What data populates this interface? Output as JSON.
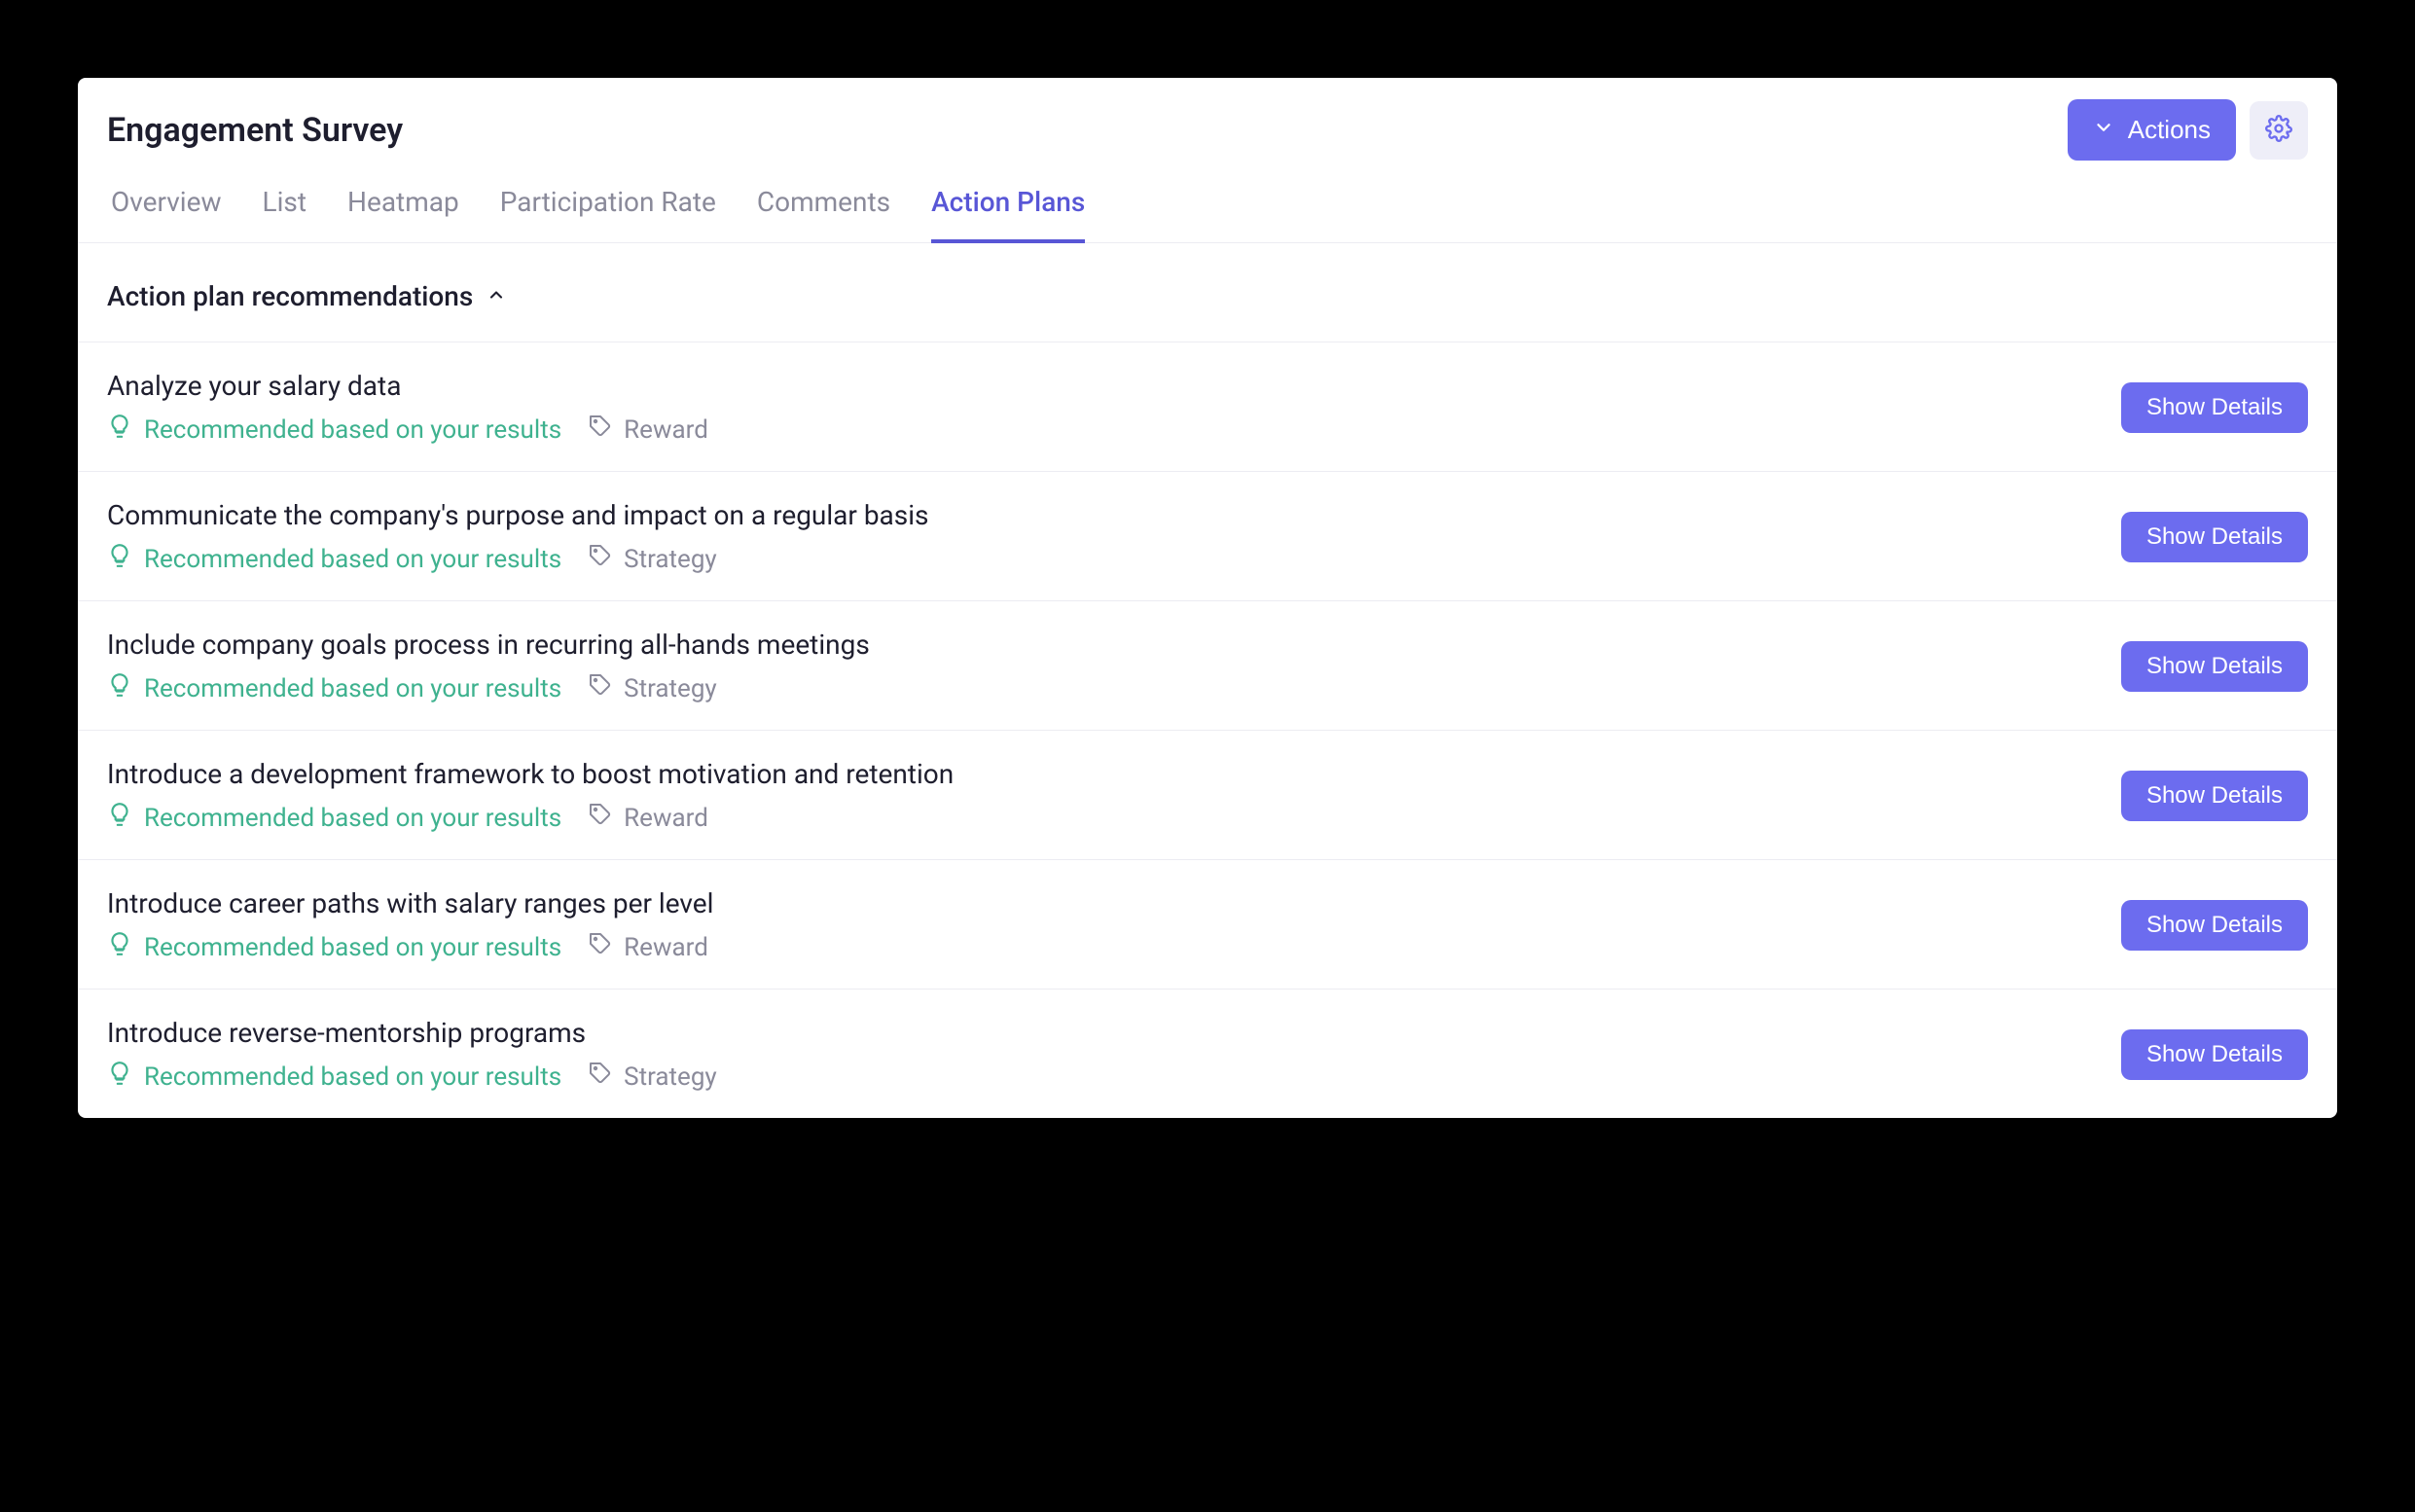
{
  "header": {
    "title": "Engagement Survey",
    "actions_label": "Actions"
  },
  "tabs": [
    {
      "label": "Overview",
      "active": false
    },
    {
      "label": "List",
      "active": false
    },
    {
      "label": "Heatmap",
      "active": false
    },
    {
      "label": "Participation Rate",
      "active": false
    },
    {
      "label": "Comments",
      "active": false
    },
    {
      "label": "Action Plans",
      "active": true
    }
  ],
  "section": {
    "title": "Action plan recommendations"
  },
  "common": {
    "recommended_label": "Recommended based on your results",
    "show_details_label": "Show Details"
  },
  "recommendations": [
    {
      "title": "Analyze your salary data",
      "category": "Reward"
    },
    {
      "title": "Communicate the company's purpose and impact on a regular basis",
      "category": "Strategy"
    },
    {
      "title": "Include company goals process in recurring all-hands meetings",
      "category": "Strategy"
    },
    {
      "title": "Introduce a development framework to boost motivation and retention",
      "category": "Reward"
    },
    {
      "title": "Introduce career paths with salary ranges per level",
      "category": "Reward"
    },
    {
      "title": "Introduce reverse-mentorship programs",
      "category": "Strategy"
    }
  ]
}
